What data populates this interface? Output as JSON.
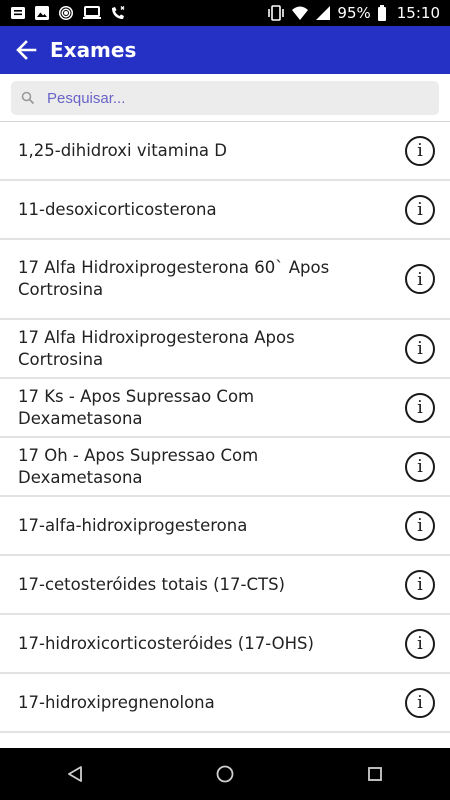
{
  "status_bar": {
    "battery": "95%",
    "time": "15:10"
  },
  "app_bar": {
    "title": "Exames"
  },
  "search": {
    "placeholder": "Pesquisar..."
  },
  "exams": [
    "1,25-dihidroxi vitamina D",
    "11-desoxicorticosterona",
    "17 Alfa Hidroxiprogesterona 60` Apos Cortrosina",
    "17 Alfa Hidroxiprogesterona Apos Cortrosina",
    "17 Ks - Apos Supressao Com Dexametasona",
    "17 Oh - Apos Supressao Com Dexametasona",
    "17-alfa-hidroxiprogesterona",
    "17-cetosteróides totais (17-CTS)",
    "17-hidroxicorticosteróides (17-OHS)",
    "17-hidroxipregnenolona"
  ],
  "info_glyph": "i",
  "colors": {
    "app_bar": "#2431c4",
    "placeholder": "#6a63c9"
  }
}
